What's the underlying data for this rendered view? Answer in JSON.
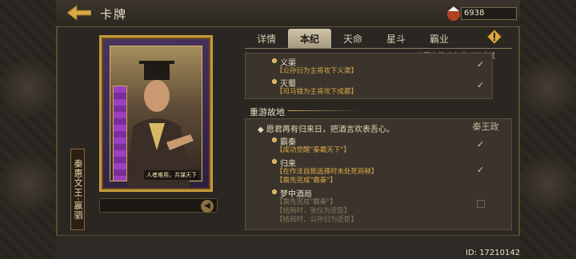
{
  "header": {
    "title": "卡牌",
    "currency_value": "6938"
  },
  "card": {
    "name": "秦惠文王·嬴驷",
    "caption": "人者难用，共谋天下"
  },
  "tabs": [
    {
      "label": "详情"
    },
    {
      "label": "本纪"
    },
    {
      "label": "天命"
    },
    {
      "label": "星斗"
    },
    {
      "label": "霸业"
    }
  ],
  "hint_text": "在历史模式完成以下成就",
  "achievements_top": [
    {
      "title": "义渠",
      "desc": "【公孙衍为主将攻下义渠】",
      "done": true
    },
    {
      "title": "灭蜀",
      "desc": "【司马错为主将攻下成都】",
      "done": true
    }
  ],
  "section": {
    "title": "重游故地",
    "quote": "愿君再有归来日，把酒言欢表吾心。",
    "stamp": "秦王政"
  },
  "achievements_bottom": [
    {
      "title": "霸秦",
      "lines": [
        "【成功觉醒\"秦霸天下\"】"
      ],
      "done": true
    },
    {
      "title": "归来",
      "lines": [
        "【在作法自毙选择时未处死商鞅】",
        "【需先完成\"霸秦\"】"
      ],
      "done": true
    },
    {
      "title": "梦中酒局",
      "lines": [
        "【需先完成\"霸秦\"】",
        "【结局时，张仪为近臣】",
        "【结局时，公孙衍为近臣】"
      ],
      "done": false
    }
  ],
  "footer": {
    "id_text": "ID: 17210142"
  },
  "colors": {
    "accent_gold": "#d9a847",
    "active_tab": "#cfc3a8"
  }
}
